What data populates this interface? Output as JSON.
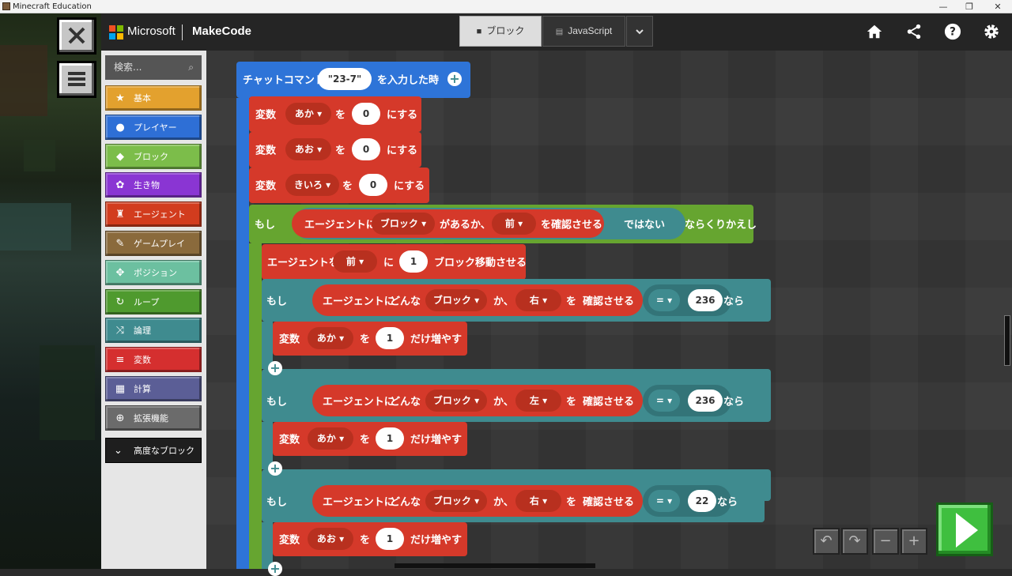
{
  "window": {
    "title": "Minecraft Education",
    "minimize": "—",
    "restore": "❐",
    "close": "✕"
  },
  "header": {
    "brand": "Microsoft",
    "product": "MakeCode",
    "tabs": {
      "blocks": "ブロック",
      "javascript": "JavaScript"
    },
    "logo_colors": [
      "#f25022",
      "#7fba00",
      "#00a4ef",
      "#ffb900"
    ]
  },
  "toolbox": {
    "search_placeholder": "検索...",
    "categories": [
      {
        "label": "基本",
        "color": "#e3a12e",
        "icon": "star-icon"
      },
      {
        "label": "プレイヤー",
        "color": "#2e6fd6",
        "icon": "person-icon"
      },
      {
        "label": "ブロック",
        "color": "#7cbd4a",
        "icon": "cube-icon"
      },
      {
        "label": "生き物",
        "color": "#8a35d3",
        "icon": "paw-icon"
      },
      {
        "label": "エージェント",
        "color": "#d23c1e",
        "icon": "agent-icon"
      },
      {
        "label": "ゲームプレイ",
        "color": "#8a6a3c",
        "icon": "wrench-icon"
      },
      {
        "label": "ポジション",
        "color": "#6cc0a0",
        "icon": "crosshair-icon"
      },
      {
        "label": "ループ",
        "color": "#4f9a2e",
        "icon": "loop-icon"
      },
      {
        "label": "論理",
        "color": "#3f8b8f",
        "icon": "shuffle-icon"
      },
      {
        "label": "変数",
        "color": "#d52f2f",
        "icon": "list-icon"
      },
      {
        "label": "計算",
        "color": "#5b5e96",
        "icon": "calculator-icon"
      },
      {
        "label": "拡張機能",
        "color": "#6b6b6b",
        "icon": "plus-circle-icon"
      }
    ],
    "advanced": "高度なブロック"
  },
  "code": {
    "event": {
      "prefix": "チャットコマンド",
      "command": "\"23-7\"",
      "suffix": "を入力した時"
    },
    "set_vars": [
      {
        "kw": "変数",
        "name": "あか",
        "wo": "を",
        "value": "0",
        "suffix": "にする"
      },
      {
        "kw": "変数",
        "name": "あお",
        "wo": "を",
        "value": "0",
        "suffix": "にする"
      },
      {
        "kw": "変数",
        "name": "きいろ",
        "wo": "を",
        "value": "0",
        "suffix": "にする"
      }
    ],
    "while": {
      "if_kw": "もし",
      "agent": "エージェントに",
      "kind": "ブロック",
      "exists": "があるか、",
      "dir": "前",
      "check": "を確認させる",
      "not": "ではない",
      "repeat": "ならくりかえし"
    },
    "move": {
      "prefix": "エージェントを",
      "dir": "前",
      "ni": "に",
      "count": "1",
      "suffix": "ブロック移動させる"
    },
    "ifs": [
      {
        "if_kw": "もし",
        "agent": "エージェントに",
        "which": "どんな",
        "kind": "ブロック",
        "ka": "か、",
        "dir": "右",
        "wo": "を",
        "check": "確認させる",
        "op": "=",
        "value": "236",
        "then": "なら",
        "body": {
          "kw": "変数",
          "name": "あか",
          "wo": "を",
          "value": "1",
          "suffix": "だけ増やす"
        }
      },
      {
        "if_kw": "もし",
        "agent": "エージェントに",
        "which": "どんな",
        "kind": "ブロック",
        "ka": "か、",
        "dir": "左",
        "wo": "を",
        "check": "確認させる",
        "op": "=",
        "value": "236",
        "then": "なら",
        "body": {
          "kw": "変数",
          "name": "あか",
          "wo": "を",
          "value": "1",
          "suffix": "だけ増やす"
        }
      },
      {
        "if_kw": "もし",
        "agent": "エージェントに",
        "which": "どんな",
        "kind": "ブロック",
        "ka": "か、",
        "dir": "右",
        "wo": "を",
        "check": "確認させる",
        "op": "=",
        "value": "22",
        "then": "なら",
        "body": {
          "kw": "変数",
          "name": "あお",
          "wo": "を",
          "value": "1",
          "suffix": "だけ増やす"
        }
      }
    ]
  }
}
